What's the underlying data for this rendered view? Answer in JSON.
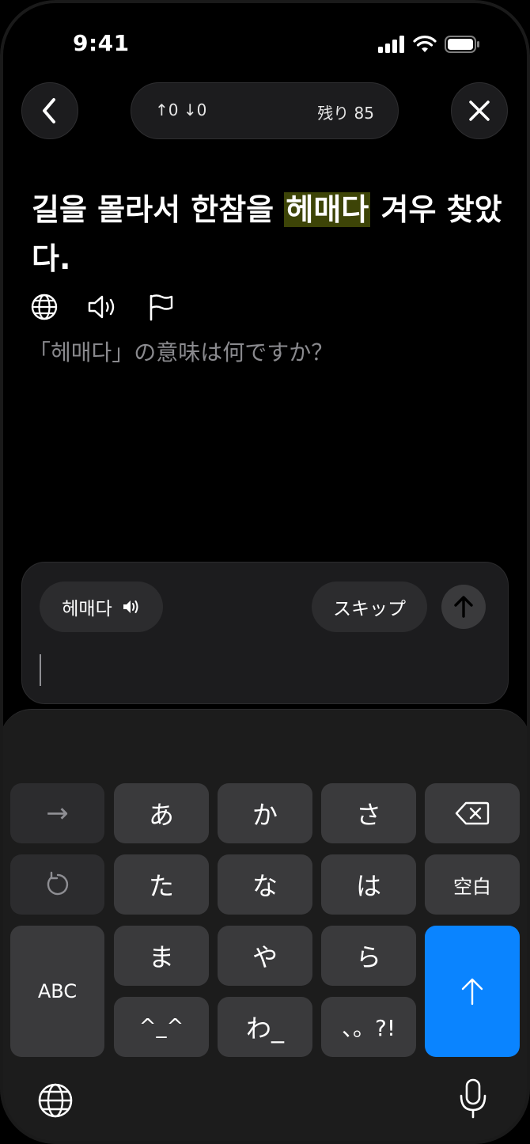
{
  "status": {
    "time": "9:41"
  },
  "header": {
    "stats": "↑0 ↓0",
    "remaining": "残り 85"
  },
  "sentence": {
    "before": "길을 몰라서 한참을 ",
    "highlight": "헤매다",
    "after": " 겨우 찾았다."
  },
  "tool_icons": [
    "globe-icon",
    "speaker-icon",
    "flag-icon"
  ],
  "question": "「헤매다」の意味は何ですか？",
  "answer": {
    "word_chip": "헤매다",
    "skip_label": "スキップ",
    "input_value": ""
  },
  "keyboard": {
    "row1": [
      "→",
      "あ",
      "か",
      "さ",
      "delete"
    ],
    "row2": [
      "undo",
      "た",
      "な",
      "は",
      "空白"
    ],
    "row3": [
      "ABC",
      "ま",
      "や",
      "ら",
      "enter"
    ],
    "row4": [
      "^_^",
      "わ_",
      "、。?!"
    ],
    "labels": {
      "arrow": "→",
      "a": "あ",
      "ka": "か",
      "sa": "さ",
      "ta": "た",
      "na": "な",
      "ha": "は",
      "space": "空白",
      "abc": "ABC",
      "ma": "ま",
      "ya": "や",
      "ra": "ら",
      "kaomoji": "^_^",
      "wa": "わ_",
      "punct": "、。?!"
    }
  },
  "colors": {
    "background": "#000000",
    "highlight": "#3d4407",
    "accent": "#0a84ff",
    "key": "#3a3a3c",
    "muted_text": "#8a8a8e"
  }
}
